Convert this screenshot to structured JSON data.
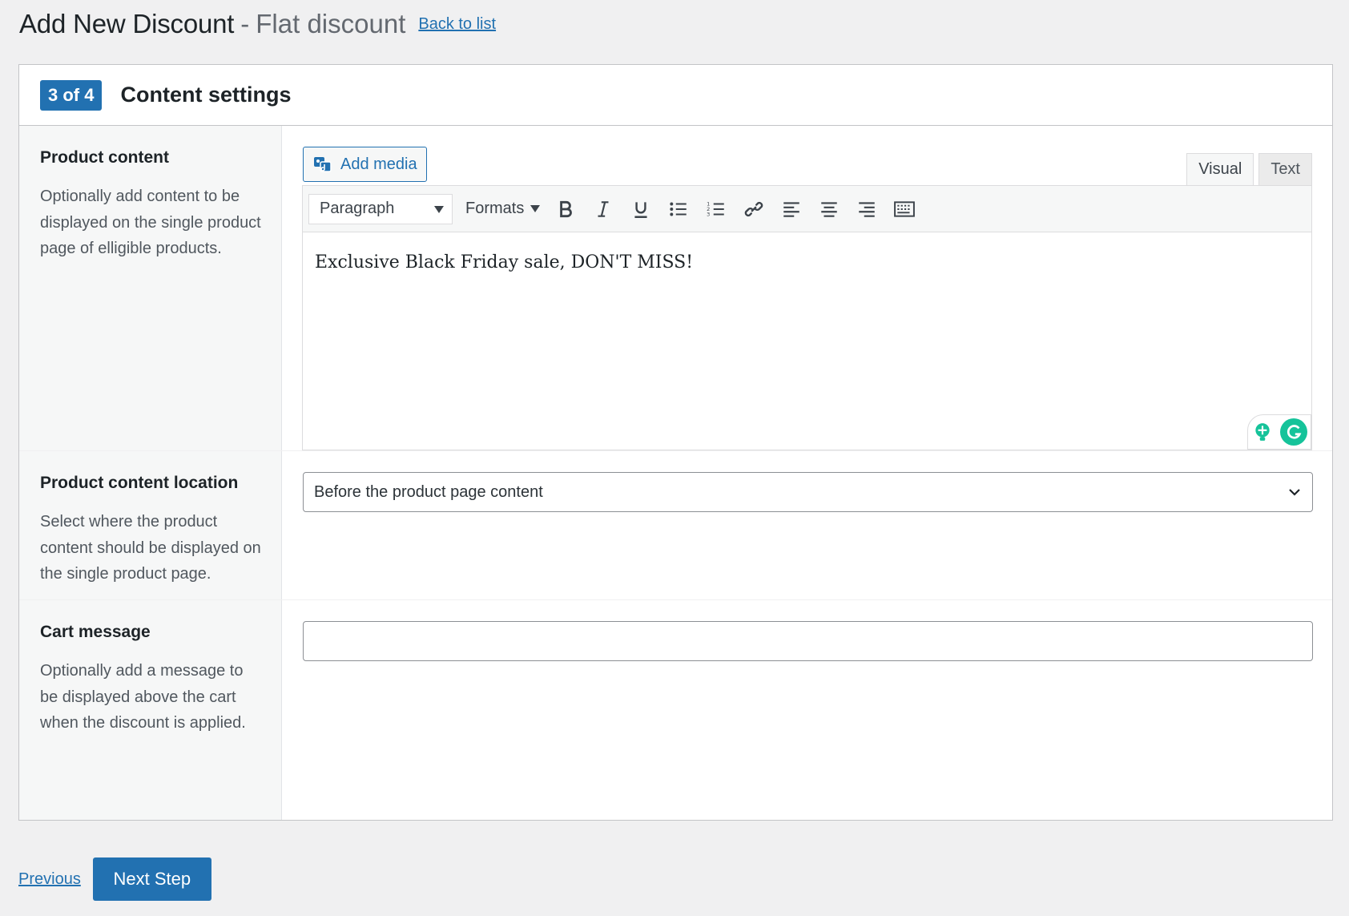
{
  "header": {
    "title": "Add New Discount",
    "separator": "-",
    "subtitle": "Flat discount",
    "back_link": "Back to list"
  },
  "panel": {
    "step_badge": "3 of 4",
    "title": "Content settings"
  },
  "rows": [
    {
      "label": "Product content",
      "description": "Optionally add content to be displayed on the single product page of elligible products."
    },
    {
      "label": "Product content location",
      "description": "Select where the product content should be displayed on the single product page."
    },
    {
      "label": "Cart message",
      "description": "Optionally add a message to be displayed above the cart when the discount is applied."
    }
  ],
  "editor": {
    "add_media_label": "Add media",
    "tabs": [
      "Visual",
      "Text"
    ],
    "active_tab": "Visual",
    "format_select": "Paragraph",
    "formats_label": "Formats",
    "content": "Exclusive Black Friday sale, DON'T MISS!",
    "toolbar_icons": [
      "bold-icon",
      "italic-icon",
      "underline-icon",
      "bullet-list-icon",
      "numbered-list-icon",
      "link-icon",
      "align-left-icon",
      "align-center-icon",
      "align-right-icon",
      "toolbar-toggle-icon"
    ]
  },
  "location_select": {
    "value": "Before the product page content"
  },
  "cart_message": {
    "value": ""
  },
  "footer": {
    "previous_label": "Previous",
    "next_label": "Next Step"
  },
  "colors": {
    "accent": "#2271b1",
    "background": "#f0f0f1",
    "grammarly": "#15c39a"
  }
}
